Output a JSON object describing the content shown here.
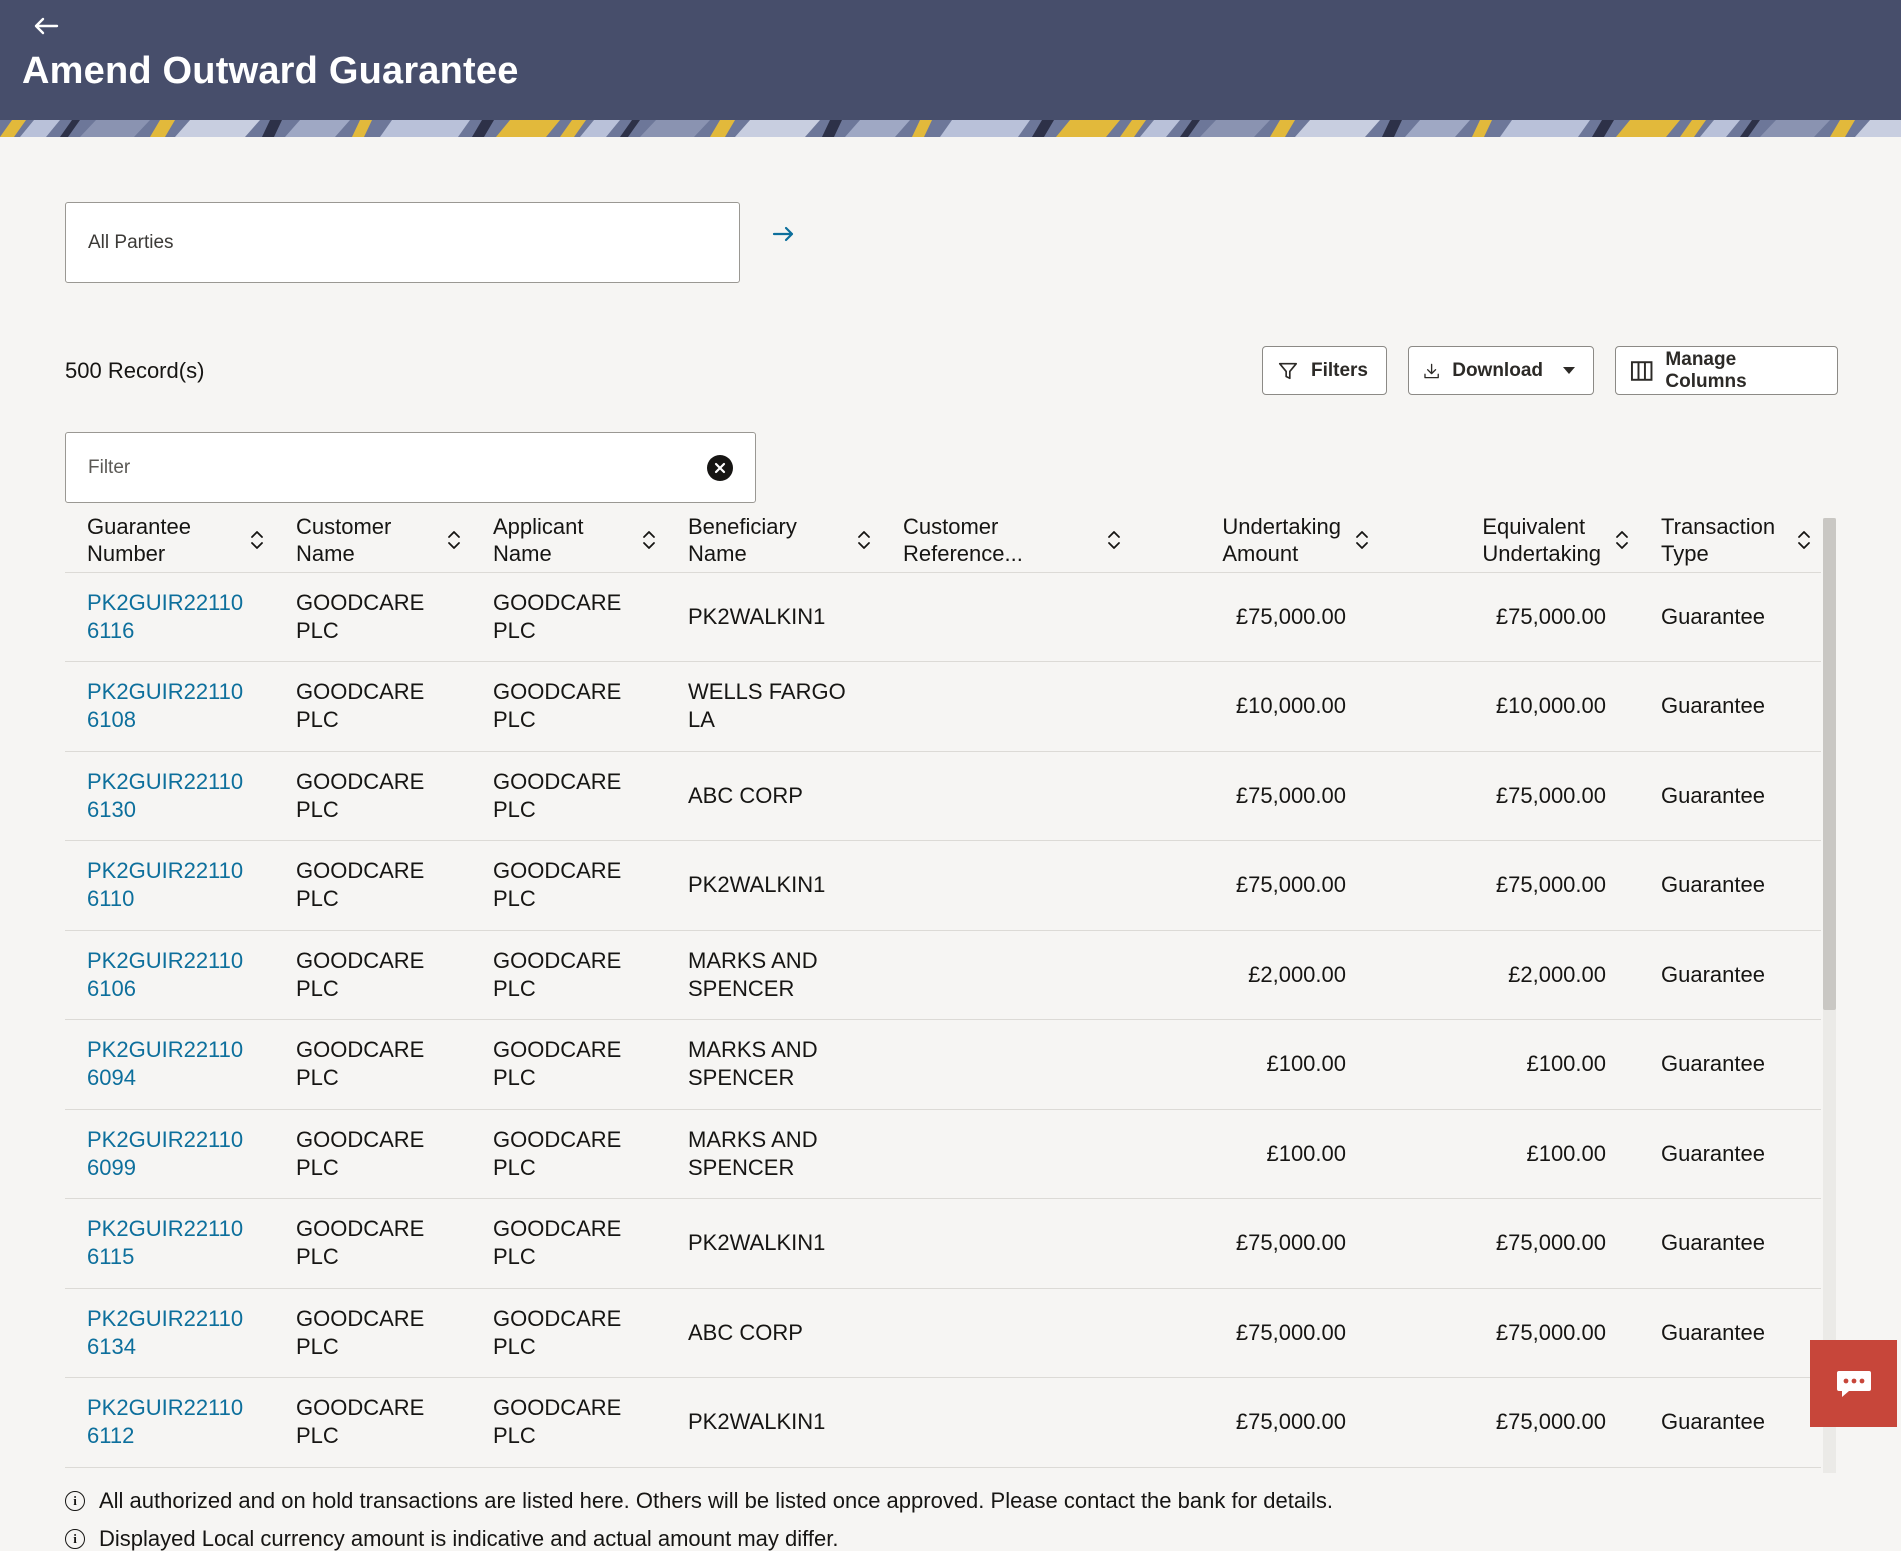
{
  "header": {
    "title": "Amend Outward Guarantee",
    "back_icon": "arrow-left-icon"
  },
  "party_selector": {
    "value": "All Parties",
    "go_icon": "arrow-right-icon"
  },
  "records": {
    "count_label": "500 Record(s)"
  },
  "toolbar": {
    "filters_label": "Filters",
    "download_label": "Download",
    "manage_columns_label": "Manage Columns"
  },
  "filter": {
    "placeholder": "Filter"
  },
  "table": {
    "columns": [
      {
        "line1": "Guarantee",
        "line2": "Number"
      },
      {
        "line1": "Customer",
        "line2": "Name"
      },
      {
        "line1": "Applicant",
        "line2": "Name"
      },
      {
        "line1": "Beneficiary",
        "line2": "Name"
      },
      {
        "line1": "Customer",
        "line2": "Reference..."
      },
      {
        "line1": "Undertaking",
        "line2": "Amount"
      },
      {
        "line1": "Equivalent",
        "line2": "Undertaking"
      },
      {
        "line1": "Transaction",
        "line2": "Type"
      }
    ],
    "rows": [
      {
        "num1": "PK2GUIR22110",
        "num2": "6116",
        "cust1": "GOODCARE",
        "cust2": "PLC",
        "app1": "GOODCARE",
        "app2": "PLC",
        "ben1": "PK2WALKIN1",
        "ben2": "",
        "ref": "",
        "amount": "£75,000.00",
        "equiv": "£75,000.00",
        "type": "Guarantee"
      },
      {
        "num1": "PK2GUIR22110",
        "num2": "6108",
        "cust1": "GOODCARE",
        "cust2": "PLC",
        "app1": "GOODCARE",
        "app2": "PLC",
        "ben1": "WELLS FARGO",
        "ben2": "LA",
        "ref": "",
        "amount": "£10,000.00",
        "equiv": "£10,000.00",
        "type": "Guarantee"
      },
      {
        "num1": "PK2GUIR22110",
        "num2": "6130",
        "cust1": "GOODCARE",
        "cust2": "PLC",
        "app1": "GOODCARE",
        "app2": "PLC",
        "ben1": "ABC CORP",
        "ben2": "",
        "ref": "",
        "amount": "£75,000.00",
        "equiv": "£75,000.00",
        "type": "Guarantee"
      },
      {
        "num1": "PK2GUIR22110",
        "num2": "6110",
        "cust1": "GOODCARE",
        "cust2": "PLC",
        "app1": "GOODCARE",
        "app2": "PLC",
        "ben1": "PK2WALKIN1",
        "ben2": "",
        "ref": "",
        "amount": "£75,000.00",
        "equiv": "£75,000.00",
        "type": "Guarantee"
      },
      {
        "num1": "PK2GUIR22110",
        "num2": "6106",
        "cust1": "GOODCARE",
        "cust2": "PLC",
        "app1": "GOODCARE",
        "app2": "PLC",
        "ben1": "MARKS AND",
        "ben2": "SPENCER",
        "ref": "",
        "amount": "£2,000.00",
        "equiv": "£2,000.00",
        "type": "Guarantee"
      },
      {
        "num1": "PK2GUIR22110",
        "num2": "6094",
        "cust1": "GOODCARE",
        "cust2": "PLC",
        "app1": "GOODCARE",
        "app2": "PLC",
        "ben1": "MARKS AND",
        "ben2": "SPENCER",
        "ref": "",
        "amount": "£100.00",
        "equiv": "£100.00",
        "type": "Guarantee"
      },
      {
        "num1": "PK2GUIR22110",
        "num2": "6099",
        "cust1": "GOODCARE",
        "cust2": "PLC",
        "app1": "GOODCARE",
        "app2": "PLC",
        "ben1": "MARKS AND",
        "ben2": "SPENCER",
        "ref": "",
        "amount": "£100.00",
        "equiv": "£100.00",
        "type": "Guarantee"
      },
      {
        "num1": "PK2GUIR22110",
        "num2": "6115",
        "cust1": "GOODCARE",
        "cust2": "PLC",
        "app1": "GOODCARE",
        "app2": "PLC",
        "ben1": "PK2WALKIN1",
        "ben2": "",
        "ref": "",
        "amount": "£75,000.00",
        "equiv": "£75,000.00",
        "type": "Guarantee"
      },
      {
        "num1": "PK2GUIR22110",
        "num2": "6134",
        "cust1": "GOODCARE",
        "cust2": "PLC",
        "app1": "GOODCARE",
        "app2": "PLC",
        "ben1": "ABC CORP",
        "ben2": "",
        "ref": "",
        "amount": "£75,000.00",
        "equiv": "£75,000.00",
        "type": "Guarantee"
      },
      {
        "num1": "PK2GUIR22110",
        "num2": "6112",
        "cust1": "GOODCARE",
        "cust2": "PLC",
        "app1": "GOODCARE",
        "app2": "PLC",
        "ben1": "PK2WALKIN1",
        "ben2": "",
        "ref": "",
        "amount": "£75,000.00",
        "equiv": "£75,000.00",
        "type": "Guarantee"
      }
    ],
    "sort_icon": "sort-icon"
  },
  "notes": [
    "All authorized and on hold transactions are listed here. Others will be listed once approved. Please contact the bank for details.",
    "Displayed Local currency amount is indicative and actual amount may differ."
  ],
  "colors": {
    "header_bg": "#474e6b",
    "link": "#0d6f9c",
    "chat_button": "#c7463a",
    "banner_accent": "#e2b93b"
  },
  "chat": {
    "icon": "chat-bubble-icon"
  }
}
